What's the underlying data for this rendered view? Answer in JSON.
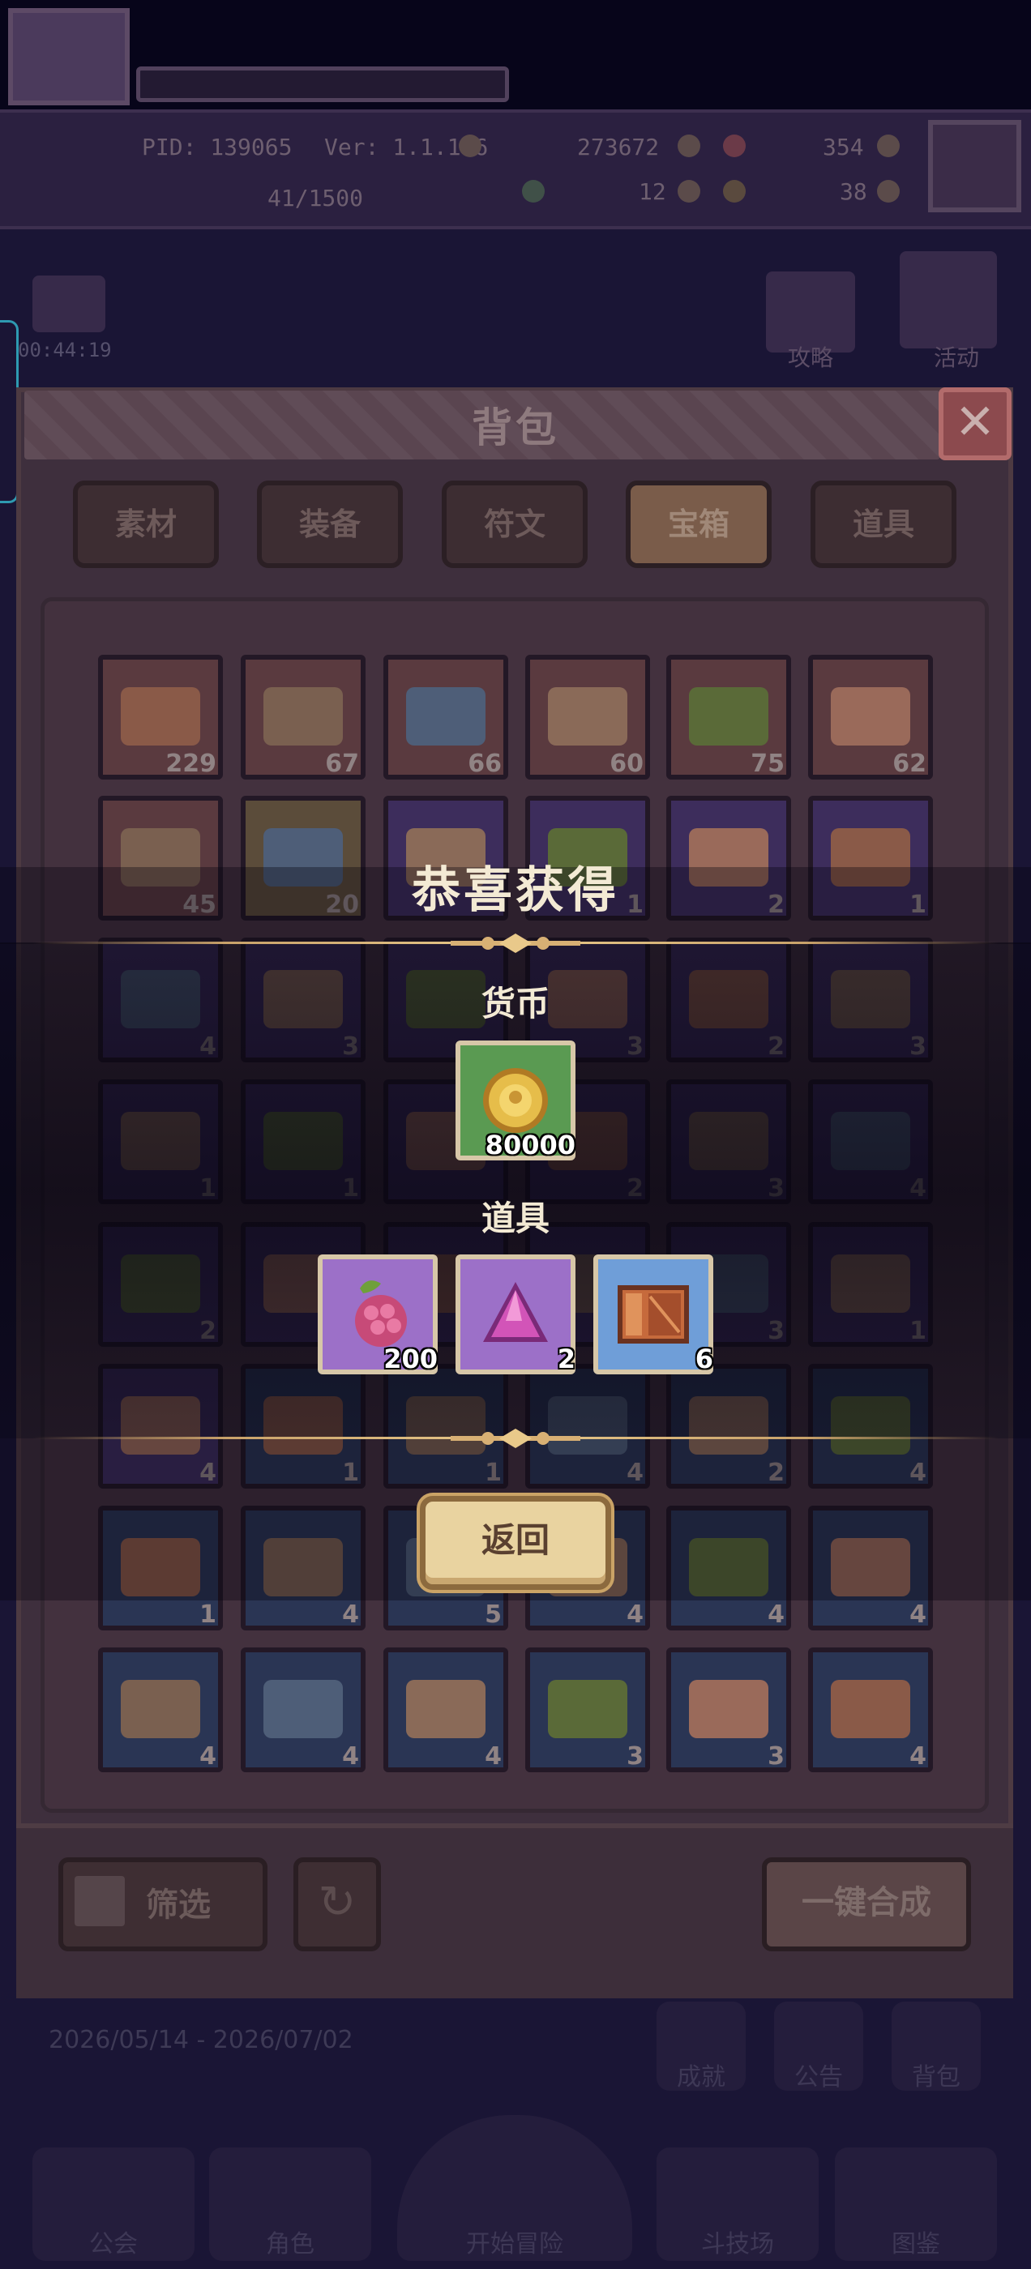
{
  "hud": {
    "pid": "PID: 139065",
    "version": "Ver: 1.1.1.6",
    "coins": "273672",
    "gems": "354",
    "exp": "41/1500",
    "clover": "12",
    "bone": "38",
    "timer": "00:44:19",
    "guide_label": "攻略",
    "event_label": "活动"
  },
  "panel": {
    "title": "背包",
    "close_icon": "close-icon",
    "tabs": [
      "素材",
      "装备",
      "符文",
      "宝箱",
      "道具"
    ],
    "active_tab": "宝箱",
    "filter_label": "筛选",
    "combine_label": "一键合成"
  },
  "grid": [
    [
      "229",
      "67",
      "66",
      "60",
      "75",
      "62"
    ],
    [
      "45",
      "20",
      "",
      "1",
      "2",
      "1"
    ],
    [
      "4",
      "3",
      "",
      "3",
      "2",
      "3"
    ],
    [
      "1",
      "1",
      "",
      "2",
      "3",
      "4"
    ],
    [
      "2",
      "",
      "",
      "",
      "3",
      "1"
    ],
    [
      "4",
      "1",
      "1",
      "4",
      "2",
      "4"
    ],
    [
      "1",
      "4",
      "5",
      "4",
      "4",
      "4"
    ],
    [
      "4",
      "4",
      "4",
      "3",
      "3",
      "4"
    ]
  ],
  "reward": {
    "title": "恭喜获得",
    "currency_label": "货币",
    "currency_items": [
      {
        "icon": "gold-coin-icon",
        "count": "80000"
      }
    ],
    "items_label": "道具",
    "items": [
      {
        "icon": "raspberry-icon",
        "count": "200"
      },
      {
        "icon": "purple-gem-icon",
        "count": "2"
      },
      {
        "icon": "wooden-crate-icon",
        "count": "6"
      }
    ],
    "return_label": "返回"
  },
  "footer": {
    "date_range": "2026/05/14 - 2026/07/02",
    "achievements": "成就",
    "notice": "公告",
    "backpack": "背包",
    "nav": [
      "公会",
      "角色",
      "开始冒险",
      "斗技场",
      "图鉴"
    ]
  }
}
